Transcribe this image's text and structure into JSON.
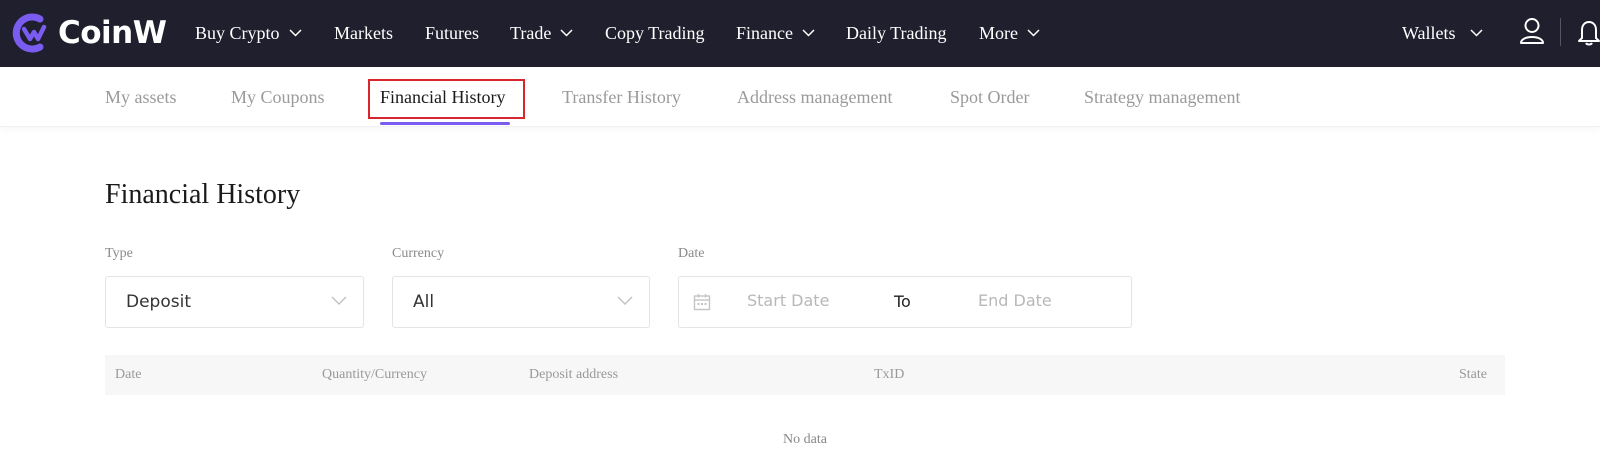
{
  "brand": {
    "name": "CoinW",
    "accent": "#7b5cf0"
  },
  "nav": {
    "items": [
      {
        "label": "Buy Crypto",
        "dropdown": true
      },
      {
        "label": "Markets",
        "dropdown": false
      },
      {
        "label": "Futures",
        "dropdown": false
      },
      {
        "label": "Trade",
        "dropdown": true
      },
      {
        "label": "Copy Trading",
        "dropdown": false
      },
      {
        "label": "Finance",
        "dropdown": true
      },
      {
        "label": "Daily Trading",
        "dropdown": false
      },
      {
        "label": "More",
        "dropdown": true
      }
    ],
    "wallets_label": "Wallets",
    "icons": [
      "user-icon",
      "bell-icon"
    ]
  },
  "subnav": {
    "tabs": [
      {
        "label": "My assets",
        "active": false
      },
      {
        "label": "My Coupons",
        "active": false
      },
      {
        "label": "Financial History",
        "active": true
      },
      {
        "label": "Transfer History",
        "active": false
      },
      {
        "label": "Address management",
        "active": false
      },
      {
        "label": "Spot Order",
        "active": false
      },
      {
        "label": "Strategy management",
        "active": false
      }
    ],
    "highlight_color": "#d7262e"
  },
  "main": {
    "title": "Financial History",
    "filters": {
      "type": {
        "label": "Type",
        "value": "Deposit"
      },
      "currency": {
        "label": "Currency",
        "value": "All"
      },
      "date": {
        "label": "Date",
        "start_placeholder": "Start Date",
        "to_label": "To",
        "end_placeholder": "End Date"
      }
    },
    "table": {
      "columns": [
        "Date",
        "Quantity/Currency",
        "Deposit address",
        "TxID",
        "State"
      ],
      "empty_text": "No data"
    }
  }
}
